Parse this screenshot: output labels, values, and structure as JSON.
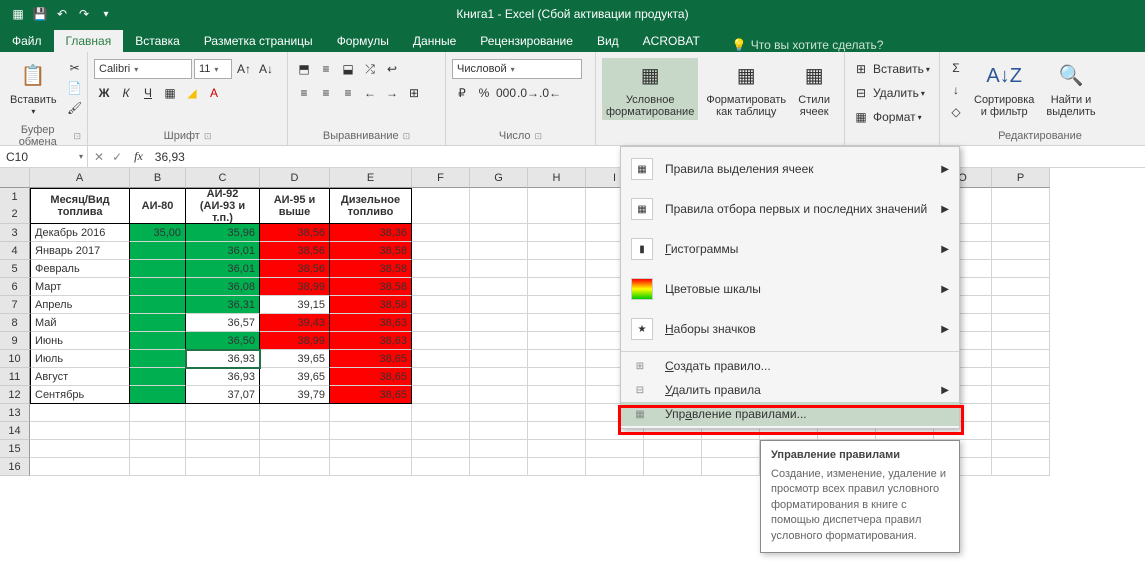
{
  "titlebar": {
    "title": "Книга1 - Excel (Сбой активации продукта)"
  },
  "tabs": [
    "Файл",
    "Главная",
    "Вставка",
    "Разметка страницы",
    "Формулы",
    "Данные",
    "Рецензирование",
    "Вид",
    "ACROBAT"
  ],
  "active_tab": 1,
  "tell_me": "Что вы хотите сделать?",
  "ribbon": {
    "clipboard": {
      "paste": "Вставить",
      "label": "Буфер обмена"
    },
    "font": {
      "name": "Calibri",
      "size": "11",
      "label": "Шрифт",
      "bold": "Ж",
      "italic": "К",
      "underline": "Ч"
    },
    "alignment": {
      "label": "Выравнивание"
    },
    "number": {
      "format": "Числовой",
      "label": "Число"
    },
    "cf": {
      "btn": "Условное\nформатирование",
      "fmt_table": "Форматировать\nкак таблицу",
      "styles": "Стили\nячеек"
    },
    "cells": {
      "insert": "Вставить",
      "delete": "Удалить",
      "format": "Формат"
    },
    "editing": {
      "sort": "Сортировка\nи фильтр",
      "find": "Найти и\nвыделить",
      "label": "Редактирование"
    }
  },
  "namebox": "C10",
  "formula": "36,93",
  "columns": [
    "A",
    "B",
    "C",
    "D",
    "E",
    "F",
    "G",
    "H",
    "I",
    "J",
    "K",
    "L",
    "M",
    "N",
    "O",
    "P"
  ],
  "col_widths": [
    "wA",
    "wB",
    "wC",
    "wD",
    "wE",
    "wOther",
    "wOther",
    "wOther",
    "wOther",
    "wOther",
    "wOther",
    "wOther",
    "wOther",
    "wOther",
    "wOther",
    "wOther"
  ],
  "table": {
    "headers": [
      "Месяц/Вид топлива",
      "АИ-80",
      "АИ-92 (АИ-93 и т.п.)",
      "АИ-95 и выше",
      "Дизельное топливо"
    ],
    "rows": [
      {
        "r": 3,
        "label": "Декабрь 2016",
        "v": [
          "35,00",
          "35,96",
          "38,56",
          "38,36"
        ],
        "c": [
          "green",
          "green",
          "red",
          "red"
        ]
      },
      {
        "r": 4,
        "label": "Январь 2017",
        "v": [
          "",
          "36,01",
          "38,56",
          "38,58"
        ],
        "c": [
          "green",
          "green",
          "red",
          "red"
        ]
      },
      {
        "r": 5,
        "label": "Февраль",
        "v": [
          "",
          "36,01",
          "38,56",
          "38,58"
        ],
        "c": [
          "green",
          "green",
          "red",
          "red"
        ]
      },
      {
        "r": 6,
        "label": "Март",
        "v": [
          "",
          "36,08",
          "38,99",
          "38,58"
        ],
        "c": [
          "green",
          "green",
          "red",
          "red"
        ]
      },
      {
        "r": 7,
        "label": "Апрель",
        "v": [
          "",
          "36,31",
          "39,15",
          "38,58"
        ],
        "c": [
          "green",
          "green",
          "white",
          "red"
        ]
      },
      {
        "r": 8,
        "label": "Май",
        "v": [
          "",
          "36,57",
          "39,43",
          "38,63"
        ],
        "c": [
          "green",
          "white",
          "red",
          "red"
        ]
      },
      {
        "r": 9,
        "label": "Июнь",
        "v": [
          "",
          "36,50",
          "38,99",
          "38,63"
        ],
        "c": [
          "green",
          "green",
          "red",
          "red"
        ]
      },
      {
        "r": 10,
        "label": "Июль",
        "v": [
          "",
          "36,93",
          "39,65",
          "38,65"
        ],
        "c": [
          "green",
          "white",
          "white",
          "red"
        ]
      },
      {
        "r": 11,
        "label": "Август",
        "v": [
          "",
          "36,93",
          "39,65",
          "38,65"
        ],
        "c": [
          "green",
          "white",
          "white",
          "red"
        ]
      },
      {
        "r": 12,
        "label": "Сентябрь",
        "v": [
          "",
          "37,07",
          "39,79",
          "38,65"
        ],
        "c": [
          "green",
          "white",
          "white",
          "red"
        ]
      }
    ],
    "empty_rows": [
      13,
      14,
      15,
      16
    ]
  },
  "cf_menu": {
    "items": [
      "Правила выделения ячеек",
      "Правила отбора первых и последних значений",
      "Гистограммы",
      "Цветовые шкалы",
      "Наборы значков"
    ],
    "actions": [
      "Создать правило...",
      "Удалить правила",
      "Управление правилами..."
    ]
  },
  "tooltip": {
    "title": "Управление правилами",
    "body": "Создание, изменение, удаление и просмотр всех правил условного форматирования в книге с помощью диспетчера правил условного форматирования."
  }
}
